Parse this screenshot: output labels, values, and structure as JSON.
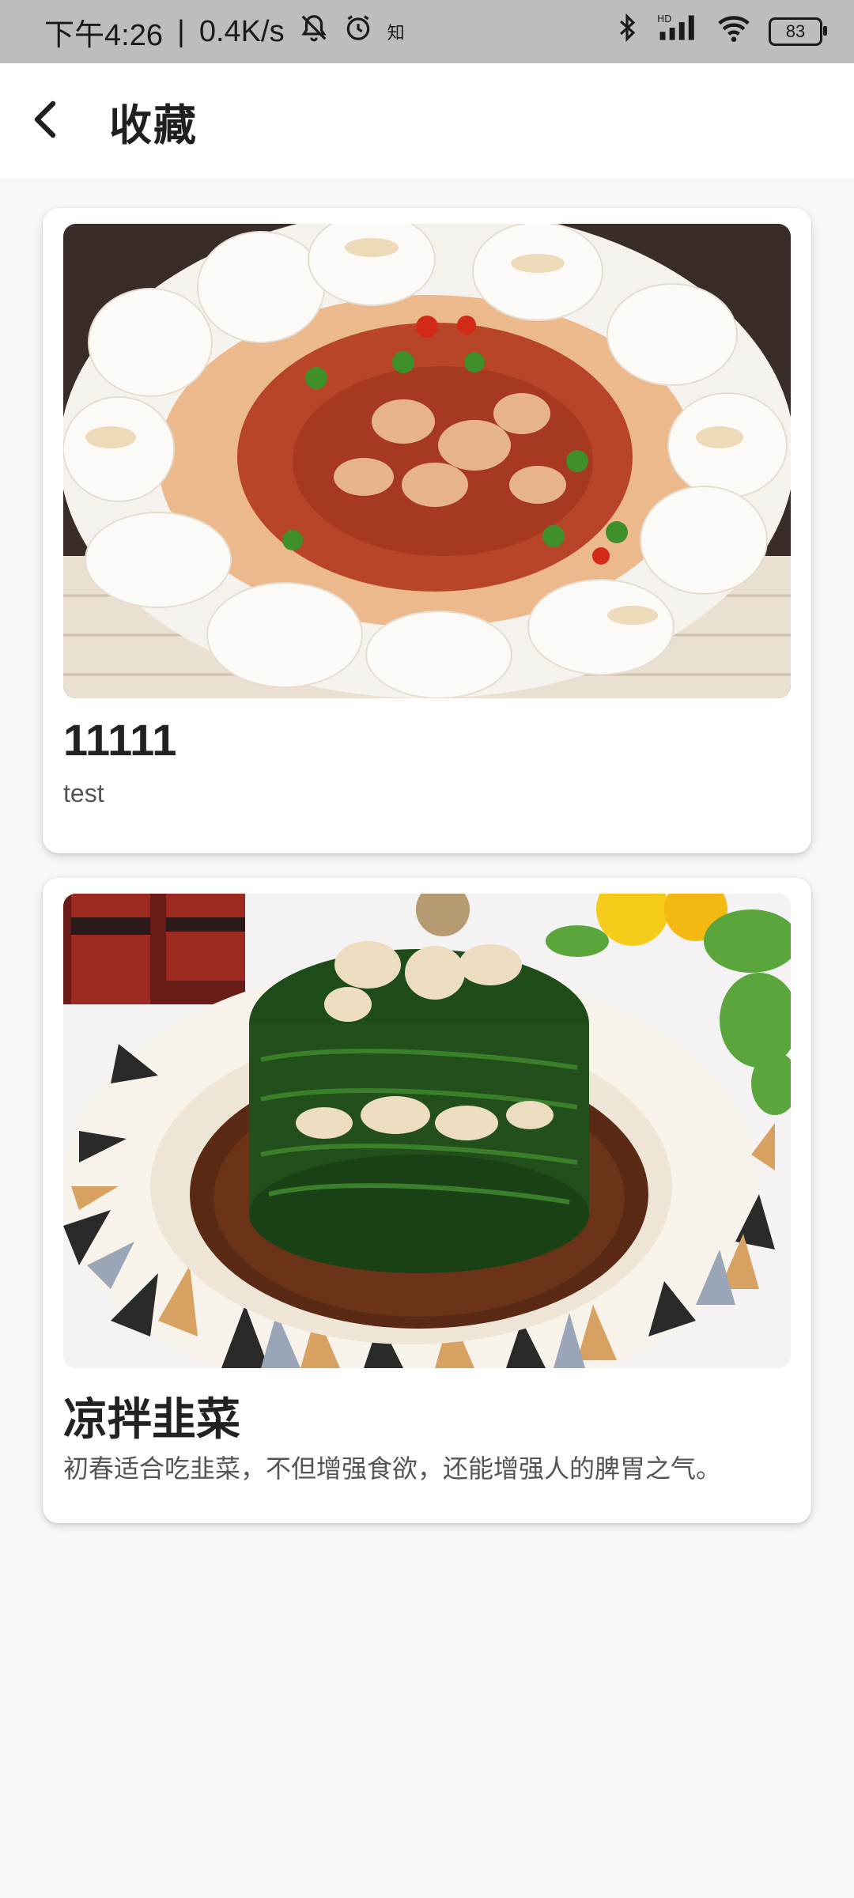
{
  "status_bar": {
    "time": "下午4:26",
    "separator": "|",
    "net_speed": "0.4K/s",
    "app_badge": "知",
    "battery": "83",
    "icons": [
      "bell-off-icon",
      "alarm-icon",
      "bluetooth-icon",
      "signal-hd-icon",
      "wifi-icon",
      "battery-icon"
    ]
  },
  "appbar": {
    "title": "收藏",
    "back_icon": "chevron-left-icon"
  },
  "favorites": [
    {
      "title": "11111",
      "description": "test",
      "image": "braised-pork-with-steamed-buns-photo"
    },
    {
      "title": "凉拌韭菜",
      "description": "初春适合吃韭菜，不但增强食欲，还能增强人的脾胃之气。",
      "image": "chive-salad-with-walnuts-photo"
    }
  ],
  "colors": {
    "status_bar_bg": "#bdbdbd",
    "page_bg": "#f7f7f7",
    "card_bg": "#ffffff"
  }
}
